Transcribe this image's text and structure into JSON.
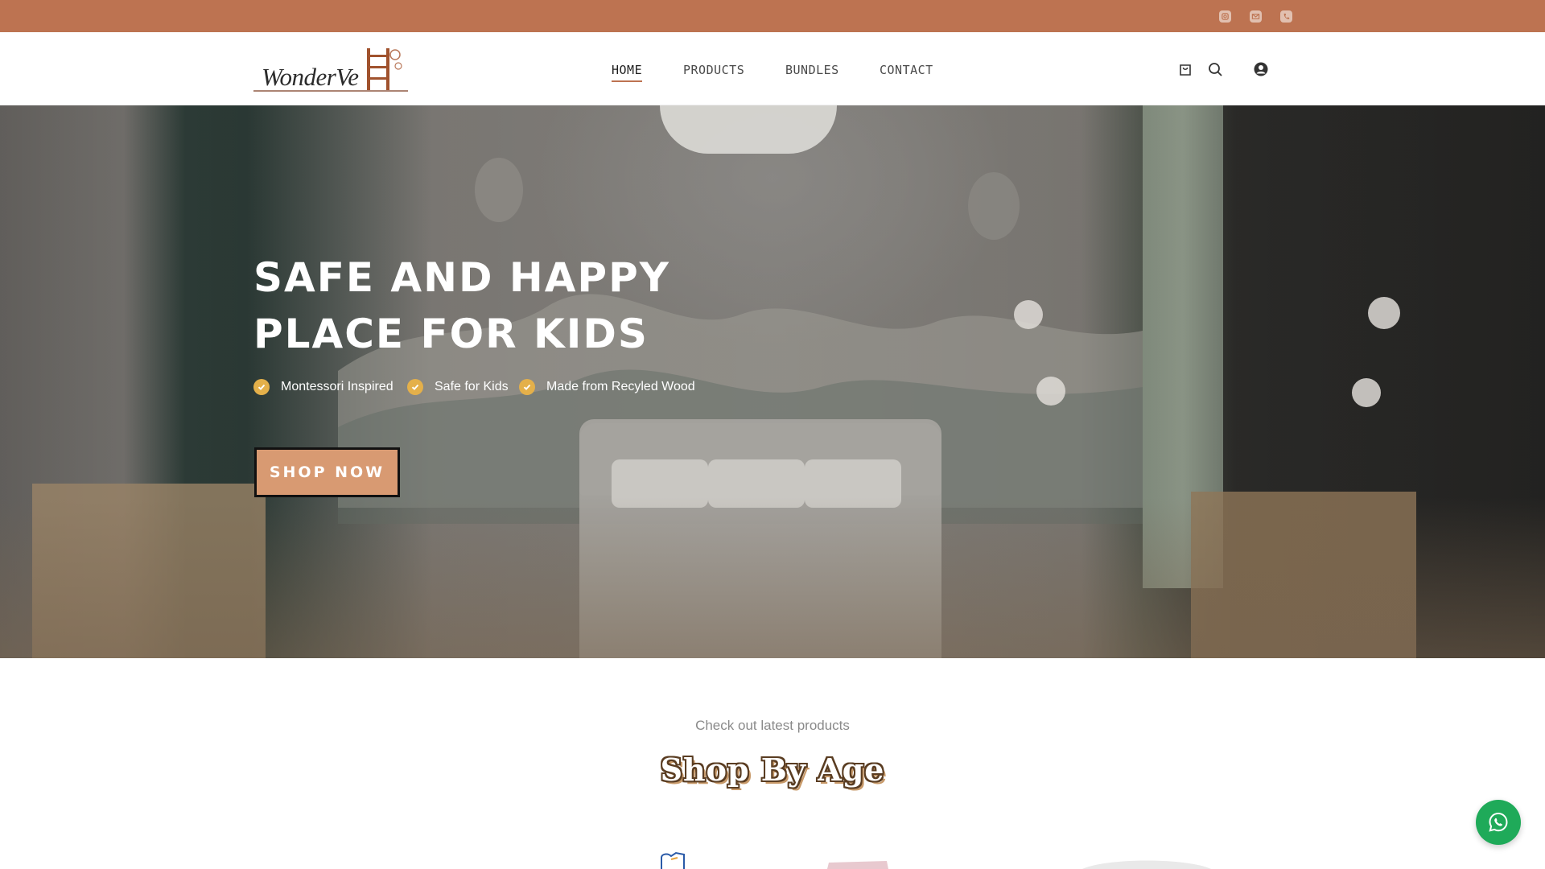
{
  "topbar": {
    "icons": [
      "instagram-icon",
      "mail-icon",
      "phone-icon"
    ],
    "color": "#bd7351"
  },
  "header": {
    "logo_text": "WonderVe",
    "nav": [
      {
        "label": "HOME",
        "active": true
      },
      {
        "label": "PRODUCTS",
        "active": false
      },
      {
        "label": "BUNDLES",
        "active": false
      },
      {
        "label": "CONTACT",
        "active": false
      }
    ],
    "icons": [
      "cart-icon",
      "search-icon",
      "account-icon"
    ]
  },
  "hero": {
    "title": "SAFE AND HAPPY PLACE FOR KIDS",
    "features": [
      "Montessori Inspired",
      "Safe for Kids",
      "Made from Recyled Wood"
    ],
    "cta": "SHOP NOW",
    "check_color": "#e4b04a",
    "cta_color": "#d89a72"
  },
  "products": {
    "subtitle": "Check out latest products",
    "title": "Shop By Age"
  },
  "floating": {
    "icon": "whatsapp-icon",
    "color": "#1faa59"
  }
}
